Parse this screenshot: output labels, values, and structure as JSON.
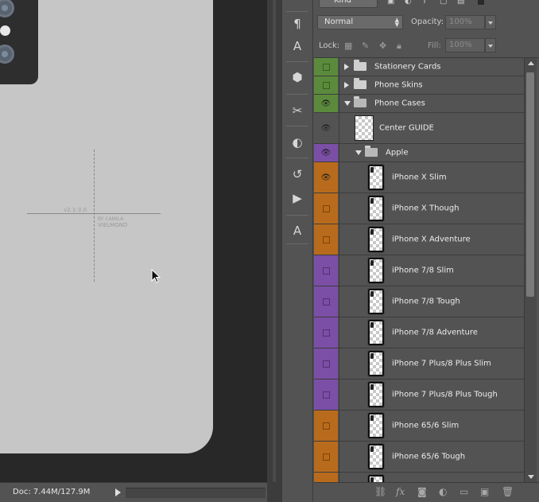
{
  "status_bar": {
    "doc_info": "Doc: 7.44M/127.9M"
  },
  "canvas": {
    "guide_version_text": "v2.1-3.0",
    "guide_credit_line1": "BY CAMILA",
    "guide_credit_line2": "VIELMOND"
  },
  "tools": [
    {
      "name": "paragraph-icon",
      "glyph": "¶"
    },
    {
      "name": "character-style-icon",
      "glyph": "A"
    },
    {
      "name": "3d-cube-icon",
      "glyph": "⬢"
    },
    {
      "name": "tools-icon",
      "glyph": "✂"
    },
    {
      "name": "adjustments-icon",
      "glyph": "◐"
    },
    {
      "name": "history-icon",
      "glyph": "↺"
    },
    {
      "name": "actions-play-icon",
      "glyph": "▶"
    },
    {
      "name": "text-tool-icon",
      "glyph": "A"
    }
  ],
  "layers_panel": {
    "filter_kind": "Kind",
    "blend_mode": "Normal",
    "opacity_label": "Opacity:",
    "opacity_value": "100%",
    "lock_label": "Lock:",
    "fill_label": "Fill:",
    "fill_value": "100%",
    "layers": [
      {
        "name": "Stationery Cards",
        "type": "group",
        "expanded": false,
        "visible": false,
        "color": "#5b8a3c"
      },
      {
        "name": "Phone Skins",
        "type": "group",
        "expanded": false,
        "visible": false,
        "color": "#5b8a3c"
      },
      {
        "name": "Phone Cases",
        "type": "group",
        "expanded": true,
        "visible": true,
        "color": "#5b8a3c"
      },
      {
        "name": "Center GUIDE",
        "type": "layer",
        "visible": true,
        "color": "#535353"
      },
      {
        "name": "Apple",
        "type": "group",
        "expanded": true,
        "visible": true,
        "color": "#7b4fa6"
      },
      {
        "name": "iPhone X Slim",
        "type": "layer",
        "visible": true,
        "color": "#b86b1c"
      },
      {
        "name": "iPhone X Though",
        "type": "layer",
        "visible": false,
        "color": "#b86b1c"
      },
      {
        "name": "iPhone X Adventure",
        "type": "layer",
        "visible": false,
        "color": "#b86b1c"
      },
      {
        "name": "iPhone 7/8 Slim",
        "type": "layer",
        "visible": false,
        "color": "#7b4fa6"
      },
      {
        "name": "iPhone 7/8 Tough",
        "type": "layer",
        "visible": false,
        "color": "#7b4fa6"
      },
      {
        "name": "iPhone 7/8 Adventure",
        "type": "layer",
        "visible": false,
        "color": "#7b4fa6"
      },
      {
        "name": "iPhone 7 Plus/8 Plus Slim",
        "type": "layer",
        "visible": false,
        "color": "#7b4fa6"
      },
      {
        "name": "iPhone 7 Plus/8 Plus Tough",
        "type": "layer",
        "visible": false,
        "color": "#7b4fa6"
      },
      {
        "name": "iPhone 65/6 Slim",
        "type": "layer",
        "visible": false,
        "color": "#b86b1c"
      },
      {
        "name": "iPhone 65/6 Tough",
        "type": "layer",
        "visible": false,
        "color": "#b86b1c"
      },
      {
        "name": "",
        "type": "layer",
        "visible": false,
        "color": "#b86b1c"
      }
    ],
    "bottom_icons": [
      "link-layers-icon",
      "fx-icon",
      "add-mask-icon",
      "adjustment-layer-icon",
      "new-group-icon",
      "new-layer-icon",
      "delete-layer-icon"
    ]
  }
}
